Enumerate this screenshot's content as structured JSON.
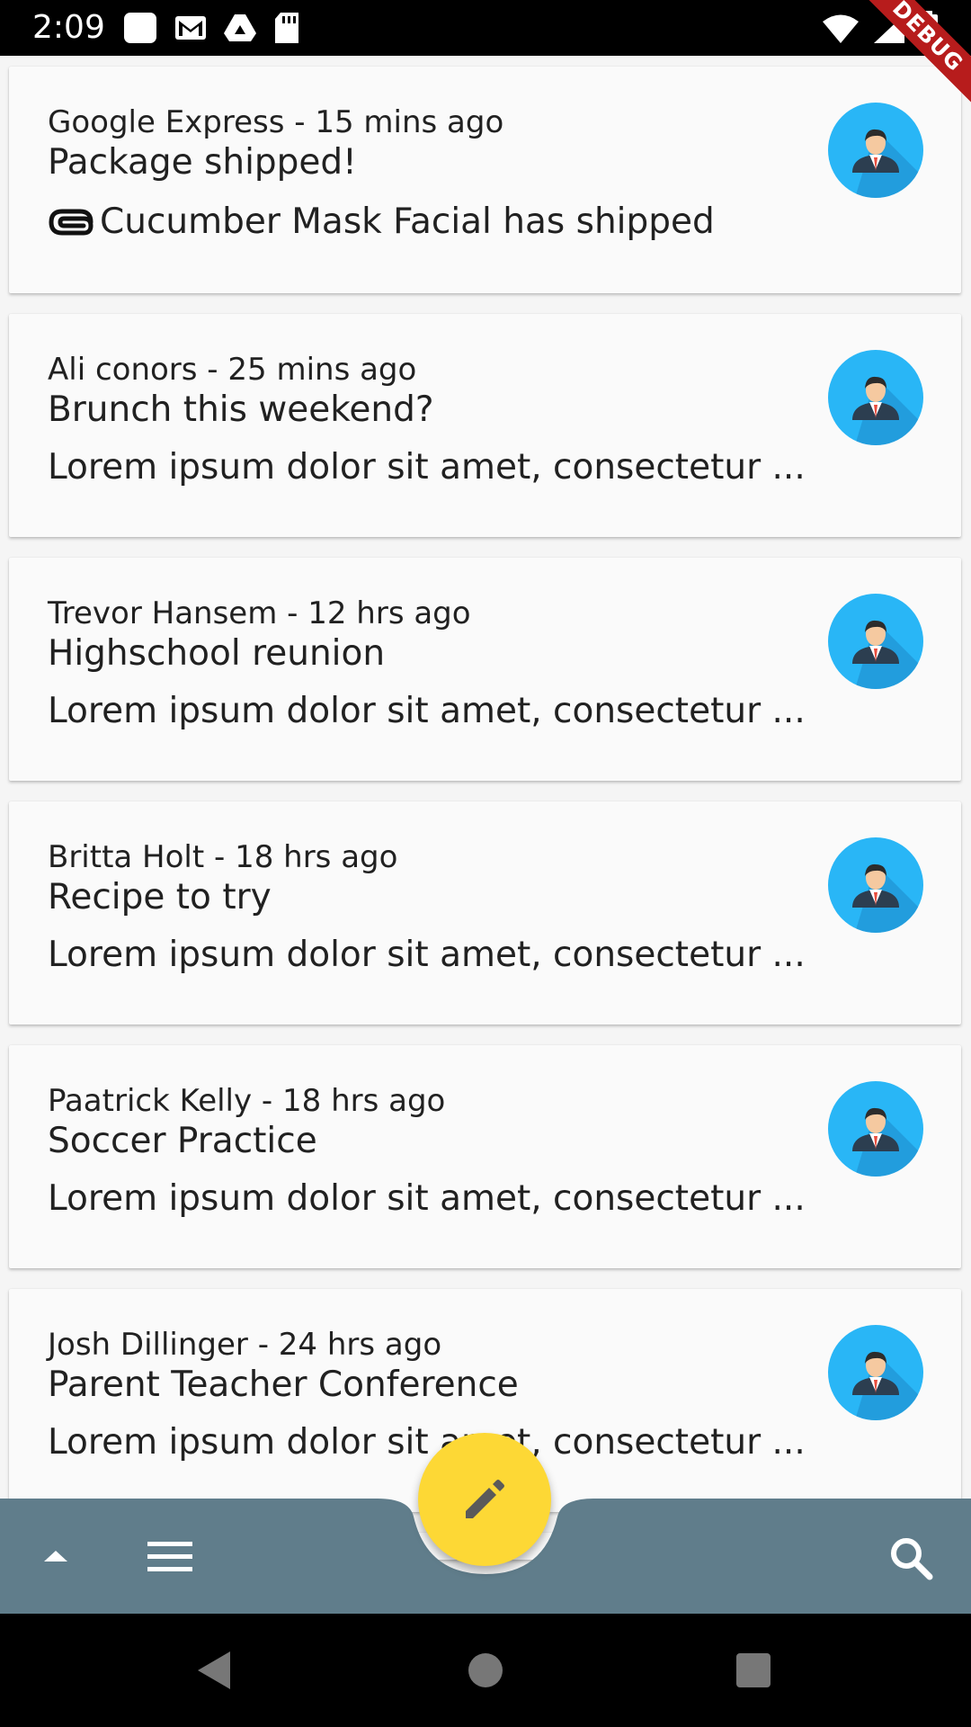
{
  "status_bar": {
    "time": "2:09",
    "left_icons": [
      "square-icon",
      "gmail-icon",
      "drive-icon",
      "sd-card-icon"
    ],
    "right_icons": [
      "wifi-icon",
      "signal-icon",
      "battery-icon"
    ],
    "debug_banner": "DEBUG"
  },
  "emails": [
    {
      "meta": "Google Express - 15 mins ago",
      "subject": "Package shipped!",
      "preview": "Cucumber Mask Facial has shipped",
      "has_attachment": true
    },
    {
      "meta": "Ali conors - 25 mins ago",
      "subject": "Brunch this weekend?",
      "preview": "Lorem ipsum dolor sit amet, consectetur ...",
      "has_attachment": false
    },
    {
      "meta": "Trevor Hansem - 12 hrs ago",
      "subject": "Highschool reunion",
      "preview": "Lorem ipsum dolor sit amet, consectetur ...",
      "has_attachment": false
    },
    {
      "meta": "Britta Holt - 18 hrs ago",
      "subject": "Recipe to try",
      "preview": "Lorem ipsum dolor sit amet, consectetur ...",
      "has_attachment": false
    },
    {
      "meta": "Paatrick Kelly - 18 hrs ago",
      "subject": "Soccer Practice",
      "preview": "Lorem ipsum dolor sit amet, consectetur ...",
      "has_attachment": false
    },
    {
      "meta": "Josh Dillinger - 24 hrs ago",
      "subject": "Parent Teacher Conference",
      "preview": "Lorem ipsum dolor sit amet, consectetur ...",
      "has_attachment": false
    }
  ],
  "bottom_bar": {
    "color": "#607d8b",
    "fab_color": "#fdd835",
    "fab_icon": "edit-icon",
    "left_icons": [
      "arrow-up-icon",
      "menu-icon"
    ],
    "right_icons": [
      "search-icon"
    ]
  },
  "nav_bar": {
    "icons": [
      "back-icon",
      "home-icon",
      "recents-icon"
    ]
  }
}
